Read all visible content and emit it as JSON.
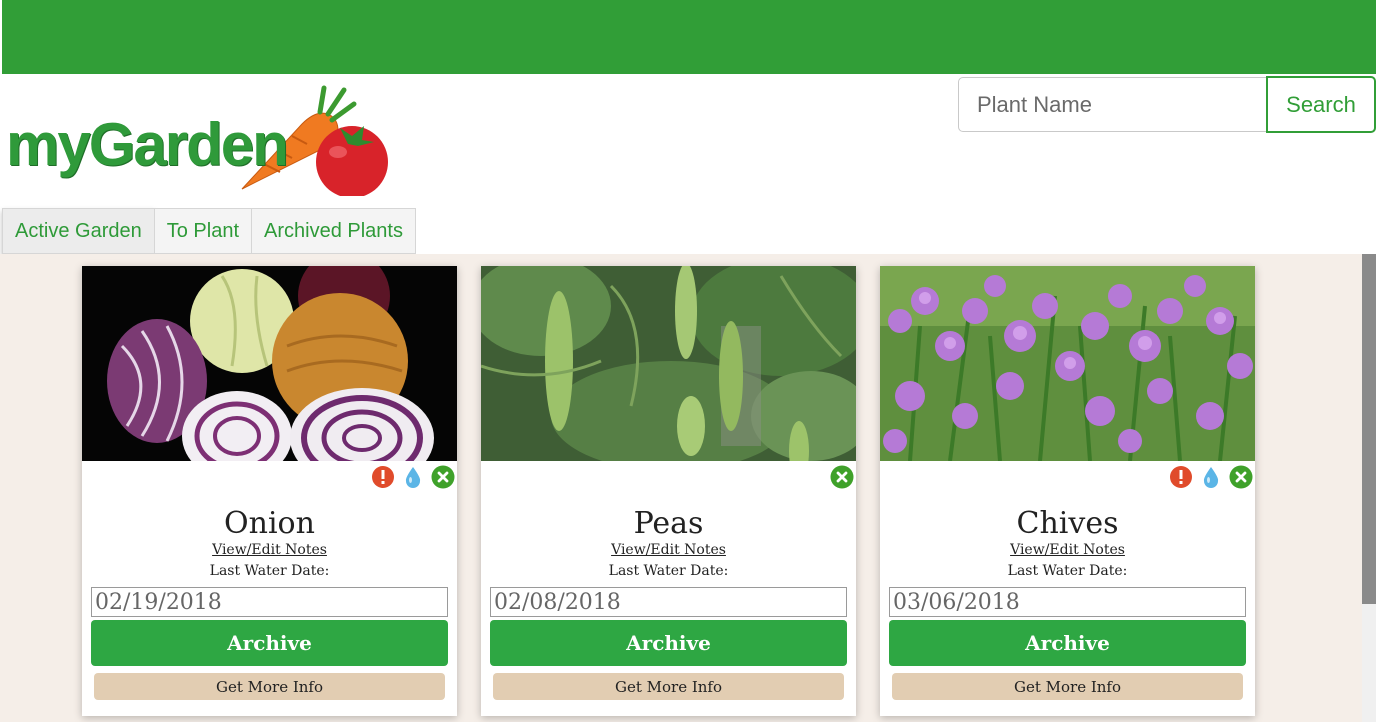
{
  "header": {
    "logo_text": "myGarden",
    "search_placeholder": "Plant Name",
    "search_button": "Search"
  },
  "tabs": [
    {
      "label": "Active Garden",
      "active": true
    },
    {
      "label": "To Plant",
      "active": false
    },
    {
      "label": "Archived Plants",
      "active": false
    }
  ],
  "colors": {
    "brand_green": "#319e37",
    "archive_green": "#2ea743",
    "info_tan": "#e2cdb2",
    "content_bg": "#f5eee8"
  },
  "cards": [
    {
      "name": "Onion",
      "image": "onions-photo",
      "status_icons": [
        "alert-icon",
        "water-drop-icon",
        "remove-icon"
      ],
      "notes_link": "View/Edit Notes",
      "water_label": "Last Water Date:",
      "last_water_date": "02/19/2018",
      "archive_label": "Archive",
      "info_label": "Get More Info"
    },
    {
      "name": "Peas",
      "image": "peas-photo",
      "status_icons": [
        "remove-icon"
      ],
      "notes_link": "View/Edit Notes",
      "water_label": "Last Water Date:",
      "last_water_date": "02/08/2018",
      "archive_label": "Archive",
      "info_label": "Get More Info"
    },
    {
      "name": "Chives",
      "image": "chives-photo",
      "status_icons": [
        "alert-icon",
        "water-drop-icon",
        "remove-icon"
      ],
      "notes_link": "View/Edit Notes",
      "water_label": "Last Water Date:",
      "last_water_date": "03/06/2018",
      "archive_label": "Archive",
      "info_label": "Get More Info"
    }
  ]
}
